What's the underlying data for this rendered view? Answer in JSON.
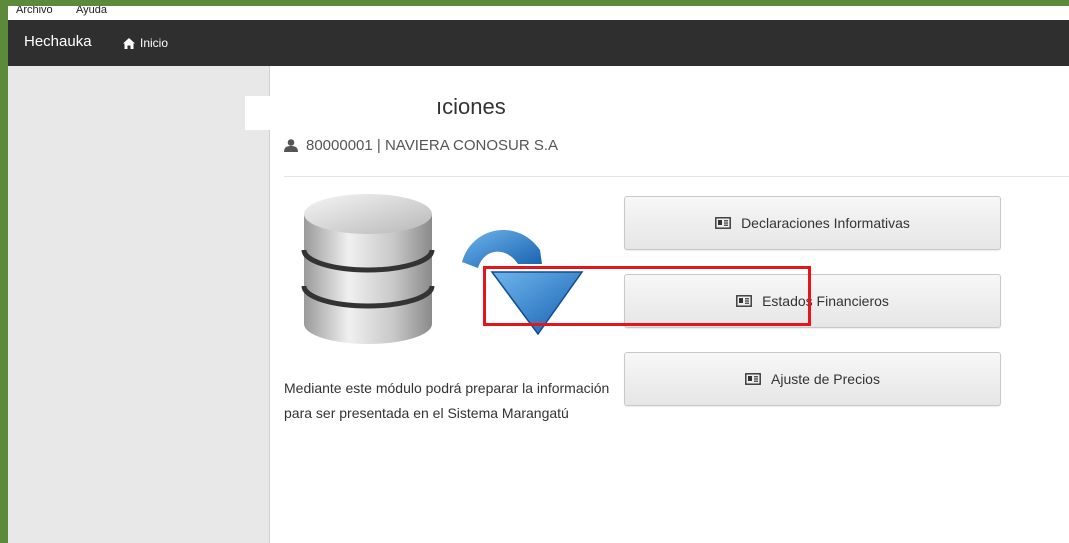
{
  "menu": {
    "file": "Archivo",
    "help": "Ayuda"
  },
  "navbar": {
    "brand": "Hechauka",
    "home_label": "Inicio"
  },
  "main": {
    "title": "ıciones",
    "user": "80000001 | NAVIERA CONOSUR S.A",
    "description": "Mediante este módulo podrá preparar la información para ser presentada en el Sistema Marangatú"
  },
  "buttons": {
    "declaraciones": "Declaraciones Informativas",
    "estados": "Estados Financieros",
    "ajuste": "Ajuste de Precios"
  },
  "colors": {
    "frame": "#5a8a3a",
    "navbar": "#2f2f2f",
    "highlight": "#e3161c",
    "arrow": "#1f78c8"
  }
}
